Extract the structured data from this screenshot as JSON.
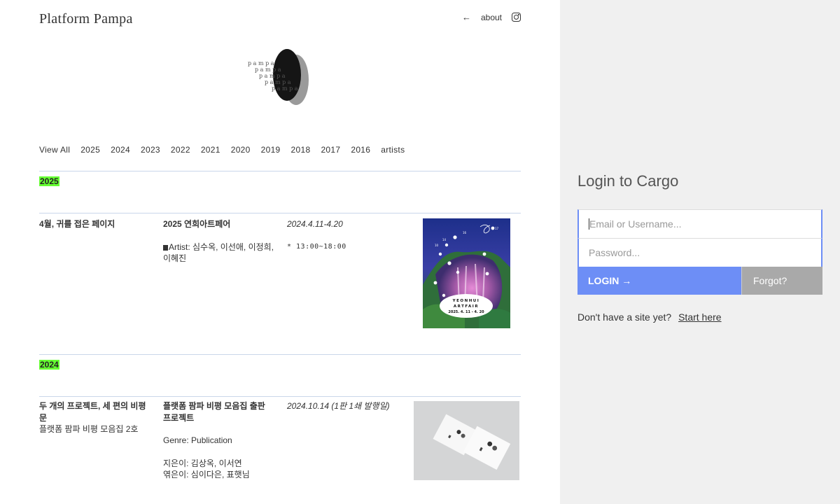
{
  "site": {
    "title": "Platform Pampa",
    "nav": {
      "back_icon": "left-arrow-icon",
      "back_label": "←",
      "about_label": "about",
      "instagram_icon": "instagram-icon"
    },
    "logo_text": [
      "p a m p a",
      "p a m p a",
      "p a m p a",
      "p a m p a",
      "p a m p a"
    ],
    "filters": [
      "View All",
      "2025",
      "2024",
      "2023",
      "2022",
      "2021",
      "2020",
      "2019",
      "2018",
      "2017",
      "2016",
      "artists"
    ]
  },
  "sections": [
    {
      "year": "2025",
      "entry": {
        "title": "4월, 귀를 접은 페이지",
        "subtitle": "",
        "project": "2025 연희아트페어",
        "artist_line": "Artist: 심수옥, 이선애, 이정희, 이혜진",
        "date": "2024.4.11-4.20",
        "hours": "* 13:00~18:00",
        "poster_text": {
          "line1": "YEONHUI",
          "line2": "ARTFAIR",
          "line3": "2025. 4. 11 - 4. 20"
        }
      }
    },
    {
      "year": "2024",
      "entry": {
        "title": "두 개의 프로젝트, 세 편의 비평문",
        "subtitle": "플랫폼 팜파 비평 모음집 2호",
        "project": "플랫폼 팜파 비평 모음집 출판 프로젝트",
        "genre": "Genre: Publication",
        "author": "지은이: 김상옥, 이서연",
        "editor": "엮은이: 심이다은, 표햇님",
        "date": "2024.10.14 (1판 1쇄 발행일)"
      }
    }
  ],
  "login": {
    "title": "Login to Cargo",
    "email_placeholder": "Email or Username...",
    "password_placeholder": "Password...",
    "login_label": "LOGIN →",
    "forgot_label": "Forgot?",
    "signup_prompt": "Don't have a site yet?",
    "signup_link": "Start here"
  },
  "colors": {
    "accent": "#6d8ef6",
    "year_highlight": "#66ff33",
    "panel_bg": "#f0f0f0"
  }
}
